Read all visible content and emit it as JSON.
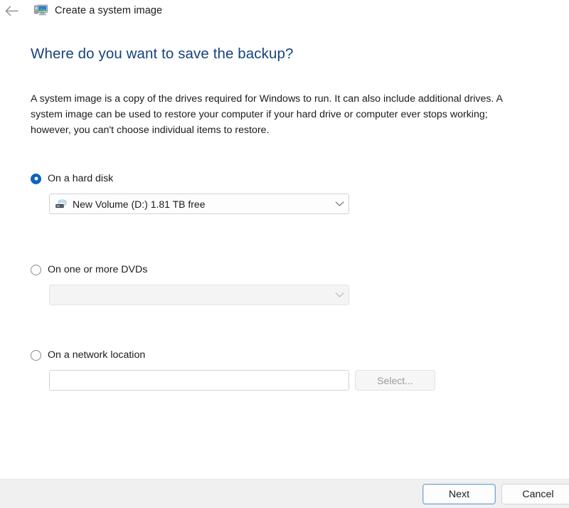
{
  "window": {
    "title": "Create a system image",
    "back_icon": "back-arrow-icon",
    "app_icon": "system-image-icon"
  },
  "page": {
    "heading": "Where do you want to save the backup?",
    "description": "A system image is a copy of the drives required for Windows to run. It can also include additional drives. A system image can be used to restore your computer if your hard drive or computer ever stops working; however, you can't choose individual items to restore.",
    "heading_color": "#16437e"
  },
  "options": {
    "hard_disk": {
      "label": "On a hard disk",
      "selected": true,
      "dropdown_value": "New Volume (D:)  1.81 TB free",
      "drive_icon": "hard-drive-icon",
      "chevron_icon": "chevron-down-icon"
    },
    "dvd": {
      "label": "On one or more DVDs",
      "selected": false,
      "dropdown_value": "",
      "chevron_icon": "chevron-down-icon"
    },
    "network": {
      "label": "On a network location",
      "selected": false,
      "path_value": "",
      "path_placeholder": "",
      "select_button_label": "Select..."
    }
  },
  "footer": {
    "next_label": "Next",
    "cancel_label": "Cancel",
    "accent_color": "#0b64c0"
  }
}
